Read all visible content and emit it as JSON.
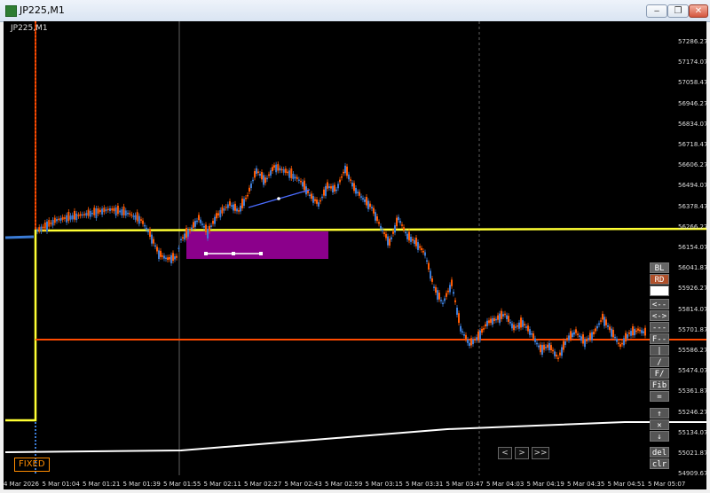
{
  "window": {
    "title": "JP225,M1",
    "minimize": "‒",
    "restore": "❐",
    "close": "✕"
  },
  "chart": {
    "symbol": "JP225,M1",
    "fixed_label": "FIXED",
    "price_labels": [
      "57286.27",
      "57174.07",
      "57058.47",
      "56946.27",
      "56834.07",
      "56718.47",
      "56606.27",
      "56494.07",
      "56378.47",
      "56266.27",
      "56154.07",
      "56041.87",
      "55926.27",
      "55814.07",
      "55701.87",
      "55586.27",
      "55474.07",
      "55361.87",
      "55246.27",
      "55134.07",
      "55021.87",
      "54909.67"
    ],
    "time_labels": [
      "4 Mar 2026",
      "5 Mar 01:04",
      "5 Mar 01:21",
      "5 Mar 01:39",
      "5 Mar 01:55",
      "5 Mar 02:11",
      "5 Mar 02:27",
      "5 Mar 02:43",
      "5 Mar 02:59",
      "5 Mar 03:15",
      "5 Mar 03:31",
      "5 Mar 03:47",
      "5 Mar 04:03",
      "5 Mar 04:19",
      "5 Mar 04:35",
      "5 Mar 04:51",
      "5 Mar 05:07"
    ],
    "colors": {
      "bull": "#3a7bd5",
      "bear": "#ff5a00",
      "yellow": "#ffff33",
      "orange_line": "#ff4a00",
      "box": "#8b008b",
      "white_line": "#ffffff"
    }
  },
  "panel": {
    "buttons": [
      "BL",
      "RD",
      "",
      "<--",
      "<->",
      "---",
      "F--",
      "|",
      "/",
      "F/",
      "Fib",
      "=",
      "↑",
      "✕",
      "↓",
      "del",
      "clr"
    ]
  },
  "nav": {
    "prev": "<",
    "next": ">",
    "end": ">>"
  }
}
